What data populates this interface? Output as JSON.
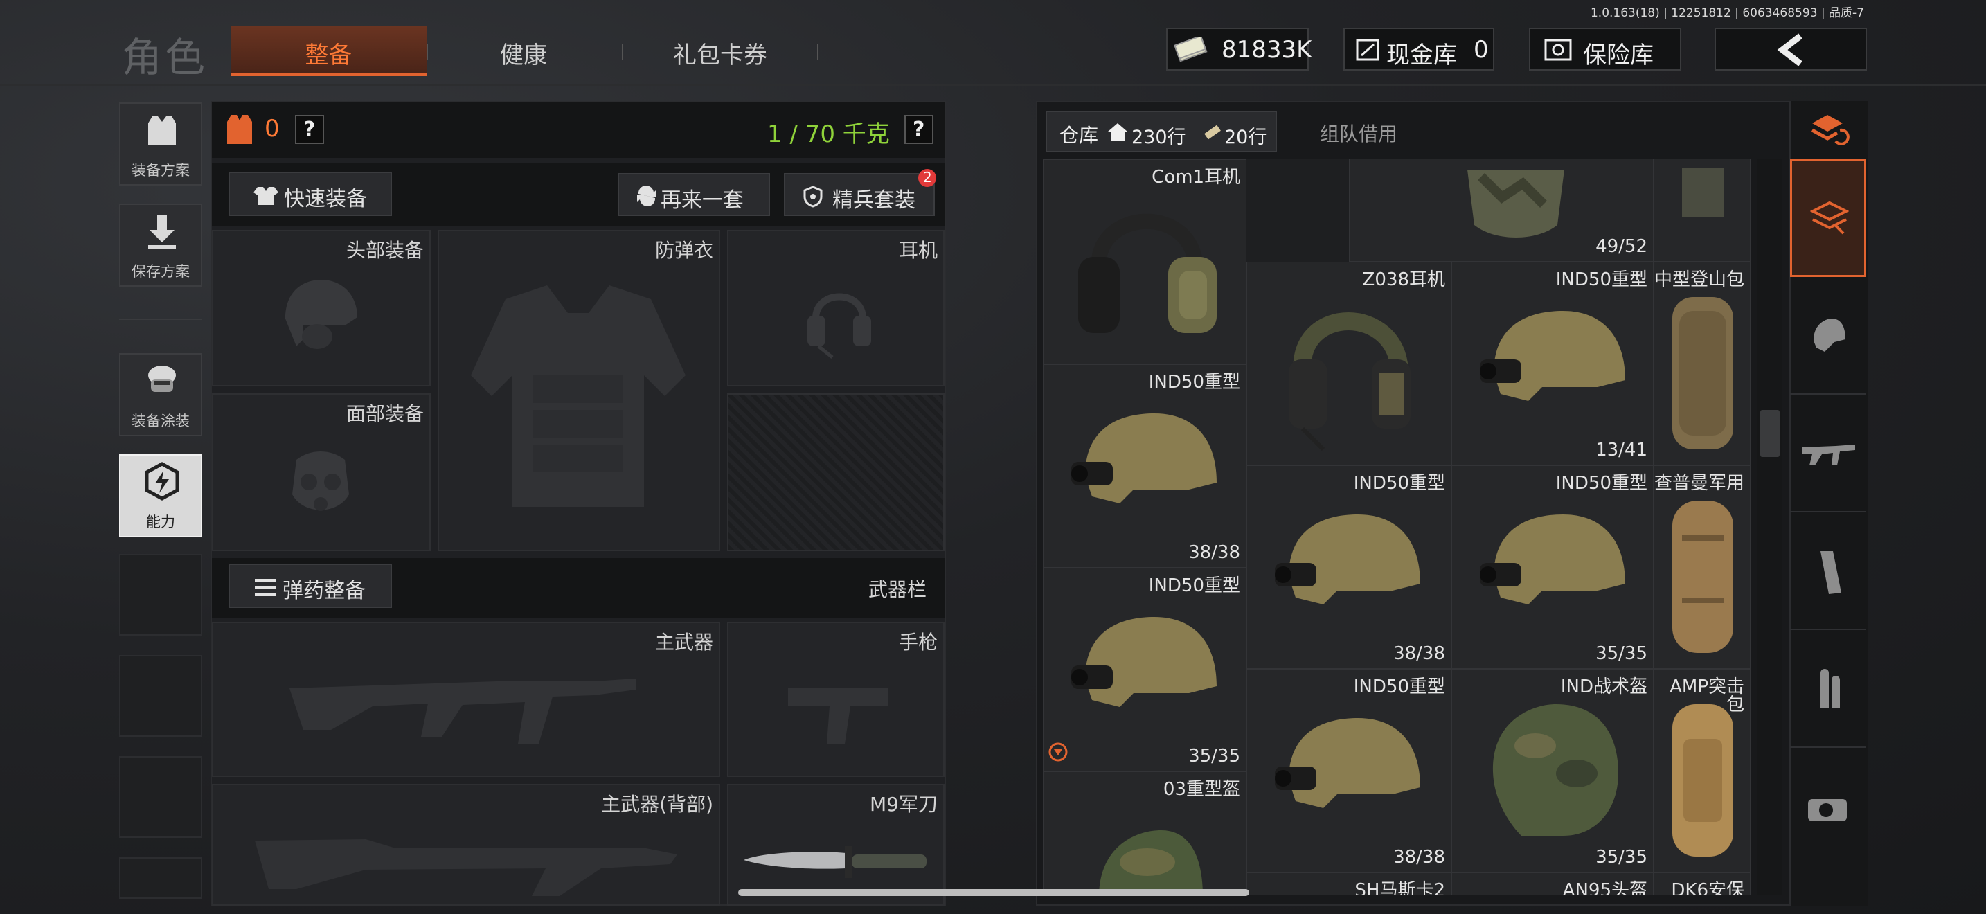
{
  "version": "1.0.163(18) | 12251812 | 6063468593 | 品质-7",
  "top_bar": {
    "role": "角色",
    "tabs": [
      "整备",
      "健康",
      "礼包卡券"
    ],
    "currency": "81833K",
    "cash_vault": "现金库",
    "cash_vault_count": "0",
    "safe": "保险库"
  },
  "left_menu": {
    "items": [
      "装备方案",
      "保存方案",
      "装备涂装",
      "能力"
    ]
  },
  "equipment": {
    "armor_count": "0",
    "help": "?",
    "weight": "1 / 70 千克",
    "quick_equip": "快速装备",
    "again": "再来一套",
    "elite_set": "精兵套装",
    "elite_badge": "2",
    "slots": {
      "head": "头部装备",
      "vest": "防弹衣",
      "earphone": "耳机",
      "face": "面部装备"
    },
    "ammo_equip": "弹药整备",
    "weapon_bar": "武器栏",
    "weapons": {
      "primary": "主武器",
      "pistol": "手枪",
      "primary_back": "主武器(背部)",
      "knife": "M9军刀"
    }
  },
  "warehouse": {
    "tab": "仓库",
    "rows": "230行",
    "extra_rows": "20行",
    "team": "组队借用",
    "items": [
      {
        "name": "",
        "count": "49/52"
      },
      {
        "name": "Com1耳机",
        "count": ""
      },
      {
        "name": "Z038耳机",
        "count": ""
      },
      {
        "name": "IND50重型",
        "count": "13/41"
      },
      {
        "name": "中型登山包",
        "count": ""
      },
      {
        "name": "IND50重型",
        "count": "38/38"
      },
      {
        "name": "IND50重型",
        "count": "38/38"
      },
      {
        "name": "IND50重型",
        "count": "35/35"
      },
      {
        "name": "查普曼军用",
        "count": ""
      },
      {
        "name": "IND50重型",
        "count": "35/35"
      },
      {
        "name": "IND50重型",
        "count": "38/38"
      },
      {
        "name": "IND战术盔",
        "count": "35/35"
      },
      {
        "name": "AMP突击",
        "name2": "包",
        "count": ""
      },
      {
        "name": "03重型盔",
        "count": ""
      },
      {
        "name": "SH马斯卡2",
        "count": ""
      },
      {
        "name": "AN95头盔",
        "count": ""
      },
      {
        "name": "DK6安保",
        "count": ""
      }
    ]
  },
  "colors": {
    "accent": "#ff7a36",
    "weight": "#8fd23a",
    "badge": "#e23a3a"
  }
}
